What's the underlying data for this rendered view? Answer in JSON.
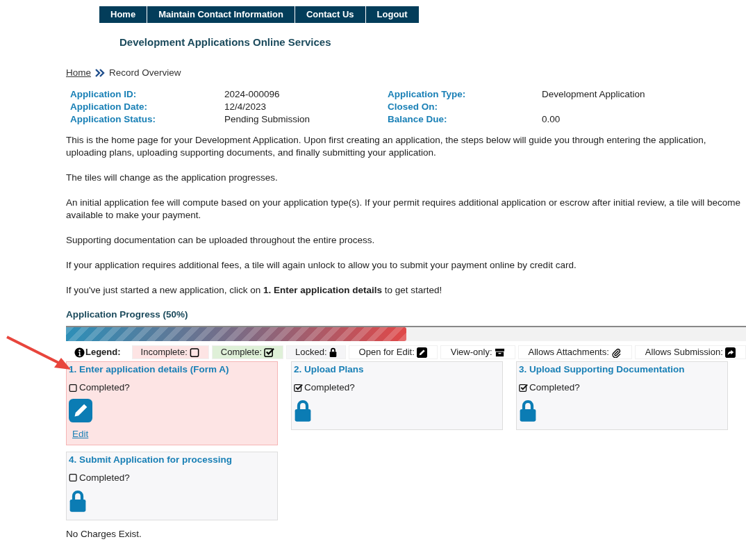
{
  "nav": [
    {
      "label": "Home"
    },
    {
      "label": "Maintain Contact Information"
    },
    {
      "label": "Contact Us"
    },
    {
      "label": "Logout"
    }
  ],
  "site_title": "Development Applications Online Services",
  "breadcrumb": {
    "home": "Home",
    "current": "Record Overview"
  },
  "details": [
    {
      "label": "Application ID:",
      "value": "2024-000096"
    },
    {
      "label": "Application Type:",
      "value": "Development Application"
    },
    {
      "label": "Application Date:",
      "value": "12/4/2023"
    },
    {
      "label": "Closed On:"
    },
    {
      "label": "Application Status:",
      "value": "Pending Submission"
    },
    {
      "label": "Balance Due:",
      "value": "0.00"
    }
  ],
  "paragraphs": [
    "This is the home page for your Development Application. Upon first creating an application, the steps below will guide you through entering the application, uploading plans, uploading supporting documents, and finally submitting your application.",
    "The tiles will change as the application progresses.",
    "An initial application fee will compute based on your application type(s). If your permit requires additional application or escrow after initial review, a tile will become available to make your payment.",
    "Supporting documentation can be uploaded throughout the entire process.",
    "If your application requires additional fees, a tile will again unlock to allow you to submit your payment online by credit card.",
    "If you've just started a new application, click on **1. Enter application details** to get started!"
  ],
  "progress": {
    "label": "Application Progress (50%)",
    "level": 0.5
  },
  "legend": {
    "title": "Legend:",
    "items": [
      {
        "label": "Incomplete:",
        "kind": "incomplete",
        "color": "#fde4e4"
      },
      {
        "label": "Complete:",
        "kind": "complete",
        "color": "#dff0d8"
      },
      {
        "label": "Locked:",
        "kind": "locked",
        "color": "#f5f5f7"
      },
      {
        "label": "Open for Edit:",
        "kind": "edit",
        "color": "#ffffff"
      },
      {
        "label": "View-only:",
        "kind": "view",
        "color": "#ffffff"
      },
      {
        "label": "Allows Attachments:",
        "kind": "attach",
        "color": "#ffffff"
      },
      {
        "label": "Allows Submission:",
        "kind": "submit",
        "color": "#ffffff"
      }
    ]
  },
  "tiles": [
    {
      "title": "1. Enter application details (Form A)",
      "completed_label": "Completed?",
      "checked": false,
      "current": true,
      "kind": "edit",
      "action": "Edit"
    },
    {
      "title": "2. Upload Plans",
      "completed_label": "Completed?",
      "checked": true,
      "current": false,
      "kind": "locked"
    },
    {
      "title": "3. Upload Supporting Documentation",
      "completed_label": "Completed?",
      "checked": true,
      "current": false,
      "kind": "locked"
    },
    {
      "title": "4. Submit Application for processing",
      "completed_label": "Completed?",
      "checked": false,
      "current": false,
      "kind": "locked"
    }
  ],
  "footer_note": "No Charges Exist."
}
